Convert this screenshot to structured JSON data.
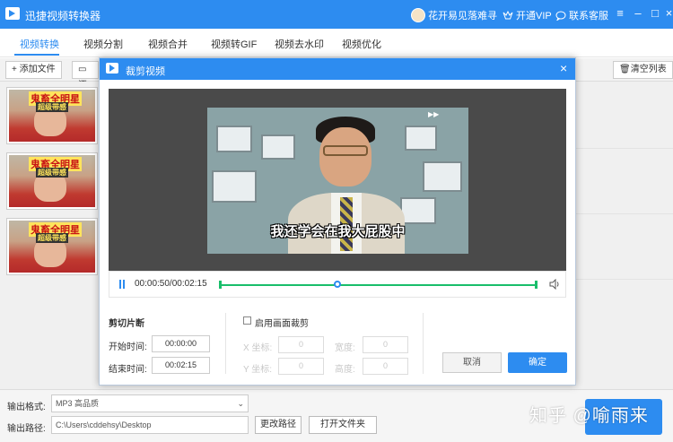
{
  "app": {
    "title": "迅捷视频转换器",
    "user_name": "花开易见落难寻",
    "vip_label": "开通VIP",
    "service_label": "联系客服"
  },
  "tabs": [
    {
      "label": "视频转换",
      "active": true
    },
    {
      "label": "视频分割",
      "active": false
    },
    {
      "label": "视频合并",
      "active": false
    },
    {
      "label": "视频转GIF",
      "active": false
    },
    {
      "label": "视频去水印",
      "active": false
    },
    {
      "label": "视频优化",
      "active": false
    }
  ],
  "toolbar": {
    "add_file_label": "添加文件",
    "add_folder_label_partial": "添",
    "clear_list_label": "清空列表"
  },
  "thumbnails": [
    {
      "caption_main": "鬼畜全明星",
      "caption_sub": "超级带感"
    },
    {
      "caption_main": "鬼畜全明星",
      "caption_sub": "超级带感"
    },
    {
      "caption_main": "鬼畜全明星",
      "caption_sub": "超级带感"
    }
  ],
  "bottom": {
    "format_label": "输出格式:",
    "format_value": "MP3  高品质",
    "path_label": "输出路径:",
    "path_value": "C:\\Users\\cddehsy\\Desktop",
    "change_path_label": "更改路径",
    "open_folder_label": "打开文件夹"
  },
  "watermark": "知乎 @喻雨来",
  "dialog": {
    "title": "裁剪视频",
    "subtitle": "我还学会在我大屁股中",
    "tv_mark": "▶▶",
    "timecode": "00:00:50/00:02:15",
    "playback_progress": 0.37,
    "clip_section_label": "剪切片断",
    "start_label": "开始时间:",
    "start_value": "00:00:00",
    "end_label": "结束时间:",
    "end_value": "00:02:15",
    "crop_checkbox_label": "启用画面裁剪",
    "crop_enabled": false,
    "x_label": "X 坐标:",
    "x_value": "0",
    "y_label": "Y 坐标:",
    "y_value": "0",
    "width_label": "宽度:",
    "width_value": "0",
    "height_label": "高度:",
    "height_value": "0",
    "cancel_label": "取消",
    "ok_label": "确定"
  },
  "colors": {
    "primary": "#2d8cf0",
    "track": "#19be6b"
  }
}
